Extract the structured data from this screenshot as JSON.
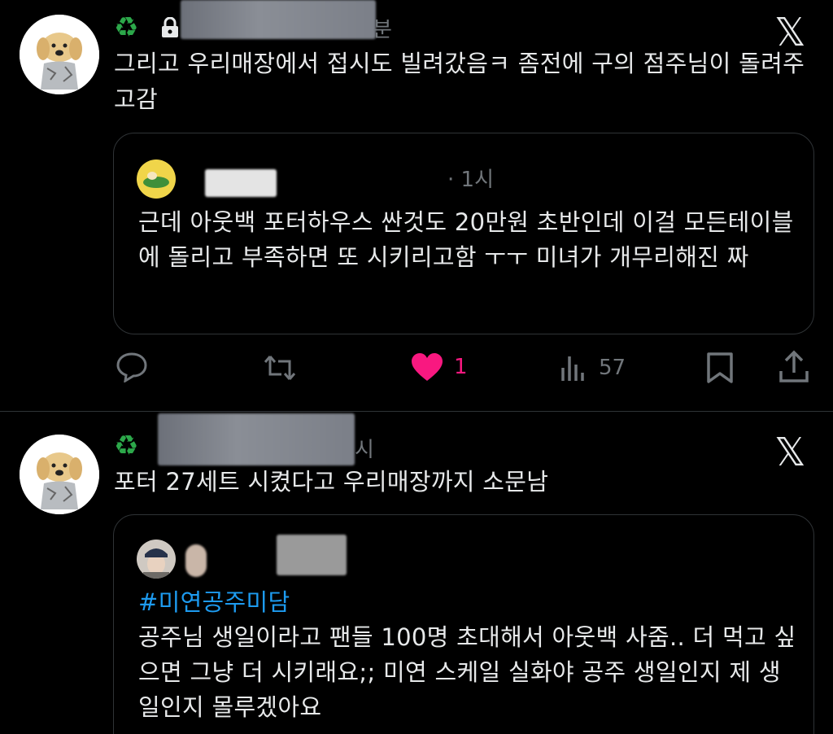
{
  "tweets": [
    {
      "time_suffix": "분",
      "text": "그리고 우리매장에서 접시도 빌려갔음ㅋ  좀전에 구의 점주님이 돌려주고감",
      "quote": {
        "time": "· 1시",
        "text": "근데 아웃백 포터하우스 싼것도 20만원 초반인데 이걸 모든테이블에 돌리고 부족하면 또 시키리고함 ㅜㅜ 미녀가 개무리해진 짜"
      },
      "actions": {
        "likes": "1",
        "views": "57"
      }
    },
    {
      "time_suffix": "시",
      "text": "포터 27세트 시켰다고 우리매장까지 소문남",
      "quote": {
        "hashtag": "#미연공주미담",
        "text": "공주님 생일이라고 팬들 100명 초대해서 아웃백 사줌.. 더 먹고 싶으면 그냥 더 시키래요;; 미연 스케일 실화야 공주 생일인지 제 생일인지 몰루겠아요"
      }
    }
  ],
  "icons": {
    "recycle": "♻",
    "x_logo": "𝕏",
    "reply": "reply-icon",
    "retweet": "retweet-icon",
    "like": "heart-icon",
    "views": "views-icon",
    "bookmark": "bookmark-icon",
    "share": "share-icon"
  },
  "colors": {
    "like": "#f91880",
    "hashtag": "#1d9bf0",
    "recycle": "#2ca84a"
  }
}
